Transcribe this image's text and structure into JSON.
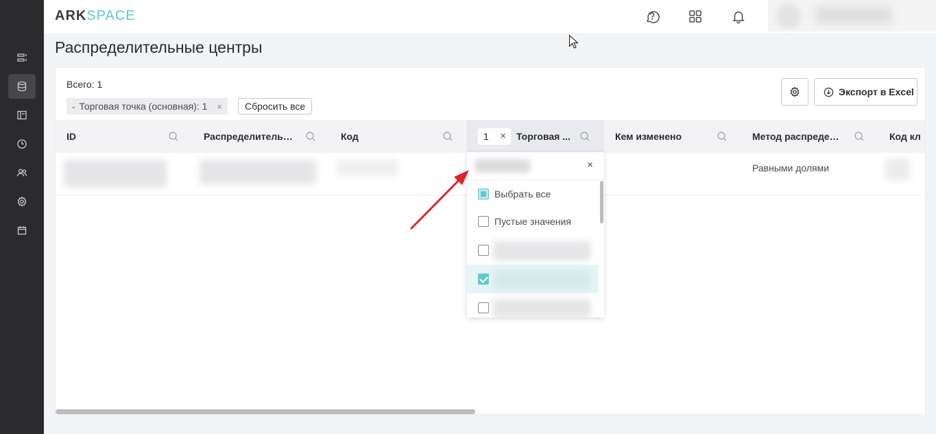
{
  "header": {
    "logo_part1": "ARK",
    "logo_part2": "SPACE",
    "icons": [
      "help-chat-icon",
      "apps-grid-icon",
      "bell-icon"
    ]
  },
  "sidebar": {
    "items": [
      {
        "name": "list-icon"
      },
      {
        "name": "database-icon",
        "active": true
      },
      {
        "name": "layout-icon"
      },
      {
        "name": "clock-icon"
      },
      {
        "name": "users-icon"
      },
      {
        "name": "gear-icon"
      },
      {
        "name": "calendar-icon"
      }
    ]
  },
  "page": {
    "title": "Распределительные центры"
  },
  "toolbar": {
    "total_label": "Всего: 1",
    "filter_chip": "Торговая точка (основная): 1",
    "reset_label": "Сбросить все",
    "export_label": "Экспорт в Excel"
  },
  "table": {
    "columns": [
      {
        "label": "ID"
      },
      {
        "label": "Распределительн..."
      },
      {
        "label": "Код"
      },
      {
        "label": "Торговая ...",
        "filter_count": "1"
      },
      {
        "label": "Кем изменено"
      },
      {
        "label": "Метод распредел..."
      },
      {
        "label": "Код кл"
      }
    ],
    "rows": [
      {
        "method": "Равными долями"
      }
    ]
  },
  "filter_dropdown": {
    "items": [
      {
        "label": "Выбрать все",
        "state": "indeterminate"
      },
      {
        "label": "Пустые значения",
        "state": "unchecked"
      }
    ]
  },
  "colors": {
    "accent": "#5fc9cc",
    "sidebar_bg": "#2b2b2e",
    "arrow": "#e0242a"
  }
}
